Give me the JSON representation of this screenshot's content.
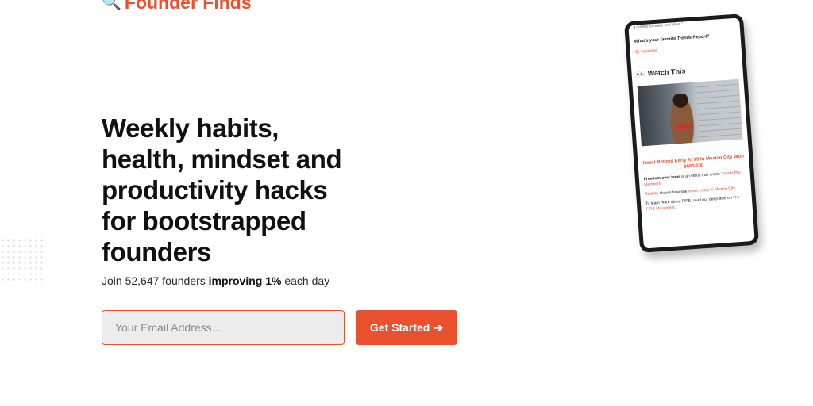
{
  "brand": {
    "name": "Founder Finds",
    "icon": "magnifier-icon"
  },
  "hero": {
    "headline": "Weekly habits, health, mindset and productivity hacks for bootstrapped founders",
    "sub_prefix": "Join 52,647 founders ",
    "sub_bold": "improving 1%",
    "sub_suffix": " each day"
  },
  "form": {
    "email_placeholder": "Your Email Address...",
    "cta_label": "Get Started",
    "cta_arrow": "➔"
  },
  "colors": {
    "accent": "#e8502e",
    "text": "#111111",
    "input_bg": "#ececec"
  },
  "tablet": {
    "quote": "it means to really feel alive.\"",
    "question": "What's your favorite Trends Report?",
    "tag": "🏚 Agencies",
    "watch_icon": "👀",
    "watch_heading": "Watch This",
    "video_title": "How I Retired Early At 39 In Mexico City With $660,000",
    "p1_bold": "Freedom over fame",
    "p1_text": " is an ethos that unites ",
    "p1_link": "Trends Pro Members.",
    "p2_link1": "Rosbita",
    "p2_text": " shares how she ",
    "p2_link2": "retired early to Mexico City.",
    "p3_text": "To learn more about FIRE, read our deep-dive on ",
    "p3_link": "The FIRE Movement."
  }
}
